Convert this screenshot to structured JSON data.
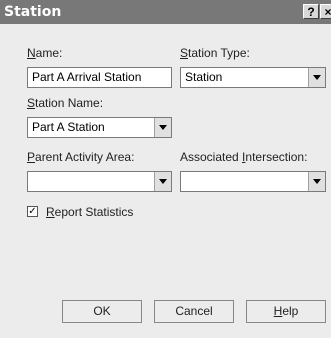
{
  "window": {
    "title": "Station",
    "help_label": "?",
    "close_label": "×"
  },
  "form": {
    "name_label_prefix": "N",
    "name_label_rest": "ame:",
    "name_value": "Part A Arrival Station",
    "station_type_label_prefix": "S",
    "station_type_label_rest": "tation Type:",
    "station_type_value": "Station",
    "station_name_label_prefix": "S",
    "station_name_label_rest": "tation Name:",
    "station_name_value": "Part A Station",
    "parent_area_label_prefix": "P",
    "parent_area_label_rest": "arent Activity Area:",
    "parent_area_value": "",
    "assoc_intersection_label_a": "Associated ",
    "assoc_intersection_label_u": "I",
    "assoc_intersection_label_b": "ntersection:",
    "assoc_intersection_value": "",
    "report_stats_checked_glyph": "✓",
    "report_stats_label_prefix": "R",
    "report_stats_label_rest": "eport Statistics"
  },
  "buttons": {
    "ok": "OK",
    "cancel": "Cancel",
    "help_prefix": "H",
    "help_rest": "elp"
  }
}
